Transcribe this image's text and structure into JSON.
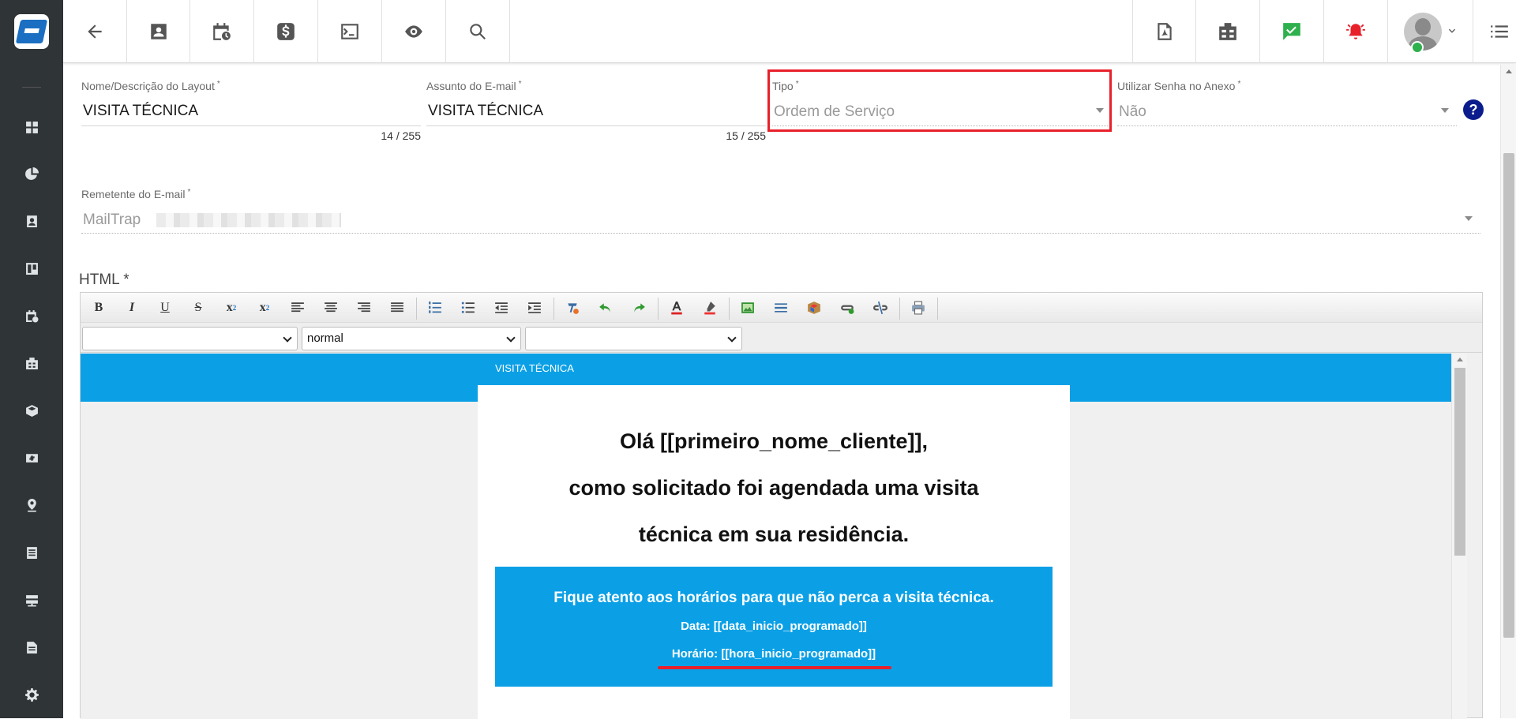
{
  "sidebar": {
    "logo_icon": "app-logo-icon",
    "items": [
      {
        "icon": "dashboard-grid-icon"
      },
      {
        "icon": "pie-chart-icon"
      },
      {
        "icon": "contact-card-icon"
      },
      {
        "icon": "kanban-board-icon"
      },
      {
        "icon": "calendar-clock-icon"
      },
      {
        "icon": "building-icon"
      },
      {
        "icon": "box-icon"
      },
      {
        "icon": "money-icon"
      },
      {
        "icon": "location-pin-icon"
      },
      {
        "icon": "list-icon"
      },
      {
        "icon": "server-icon"
      },
      {
        "icon": "document-icon"
      },
      {
        "icon": "settings-gear-icon"
      }
    ]
  },
  "topbar": {
    "left_buttons": [
      "back-arrow-icon",
      "contact-icon",
      "calendar-clock-icon",
      "dollar-icon",
      "terminal-icon",
      "eye-icon",
      "search-icon"
    ],
    "right_buttons": [
      "pdf-icon",
      "building-icon",
      "chat-check-icon",
      "alarm-bell-icon",
      "user-avatar",
      "menu-list-icon"
    ],
    "colors": {
      "chat": "#2eb04d",
      "alarm": "#e8202a",
      "status": "#2eb04d"
    }
  },
  "form": {
    "layout_name": {
      "label": "Nome/Descrição do Layout",
      "required_mark": "*",
      "value": "VISITA TÉCNICA",
      "counter": "14 / 255"
    },
    "email_subject": {
      "label": "Assunto do E-mail",
      "required_mark": "*",
      "value": "VISITA TÉCNICA",
      "counter": "15 / 255"
    },
    "type": {
      "label": "Tipo",
      "required_mark": "*",
      "value": "Ordem de Serviço"
    },
    "attachment_password": {
      "label": "Utilizar Senha no Anexo",
      "required_mark": "*",
      "value": "Não",
      "help": "?"
    },
    "sender": {
      "label": "Remetente do E-mail",
      "required_mark": "*",
      "value": "MailTrap"
    }
  },
  "editor": {
    "label": "HTML *",
    "toolbar_text": {
      "bold": "B",
      "italic": "I",
      "underline": "U",
      "strike": "S",
      "subscript": "x",
      "superscript": "x"
    },
    "selects": {
      "font": "",
      "format": "normal",
      "size": ""
    },
    "email": {
      "band_title": "VISITA TÉCNICA",
      "greeting_lines": [
        "Olá [[primeiro_nome_cliente]],",
        "como solicitado foi agendada uma visita",
        "técnica em sua residência."
      ],
      "notice": "Fique atento aos horários para que não perca a visita técnica.",
      "date_line": "Data: [[data_inicio_programado]]",
      "time_line": "Horário: [[hora_inicio_programado]]"
    }
  },
  "accent_color": "#0ba0e6",
  "highlight_color": "#e8202a"
}
